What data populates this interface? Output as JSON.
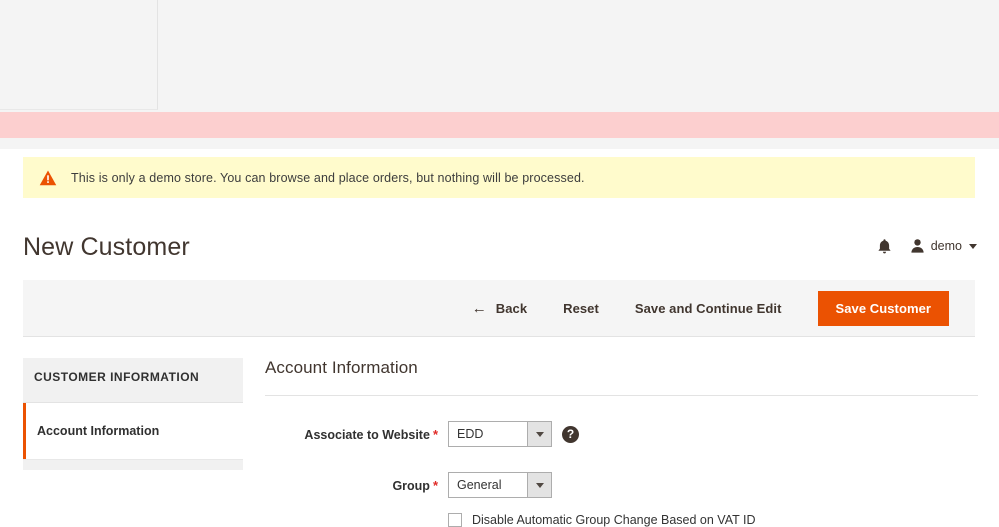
{
  "banner": {
    "icon": "warning-triangle-icon",
    "text": "This is only a demo store. You can browse and place orders, but nothing will be processed."
  },
  "header": {
    "title": "New Customer",
    "notifications_icon": "bell-icon",
    "user_icon": "user-avatar-icon",
    "user_name": "demo",
    "caret_icon": "chevron-down-icon"
  },
  "toolbar": {
    "back_arrow": "←",
    "back_label": "Back",
    "reset_label": "Reset",
    "save_continue_label": "Save and Continue Edit",
    "save_label": "Save Customer"
  },
  "sidebar": {
    "title": "CUSTOMER INFORMATION",
    "items": [
      {
        "label": "Account Information",
        "active": true
      }
    ]
  },
  "main": {
    "heading": "Account Information",
    "fields": [
      {
        "label": "Associate to Website",
        "required": "*",
        "value": "EDD",
        "help_icon": "question-mark-icon",
        "help_glyph": "?"
      },
      {
        "label": "Group",
        "required": "*",
        "value": "General"
      }
    ],
    "checkbox": {
      "label": "Disable Automatic Group Change Based on VAT ID",
      "checked": false
    }
  },
  "colors": {
    "accent": "#eb5202",
    "banner_bg": "#fffbcc",
    "strip_pink": "#fccfcf",
    "required": "#e02b27"
  }
}
